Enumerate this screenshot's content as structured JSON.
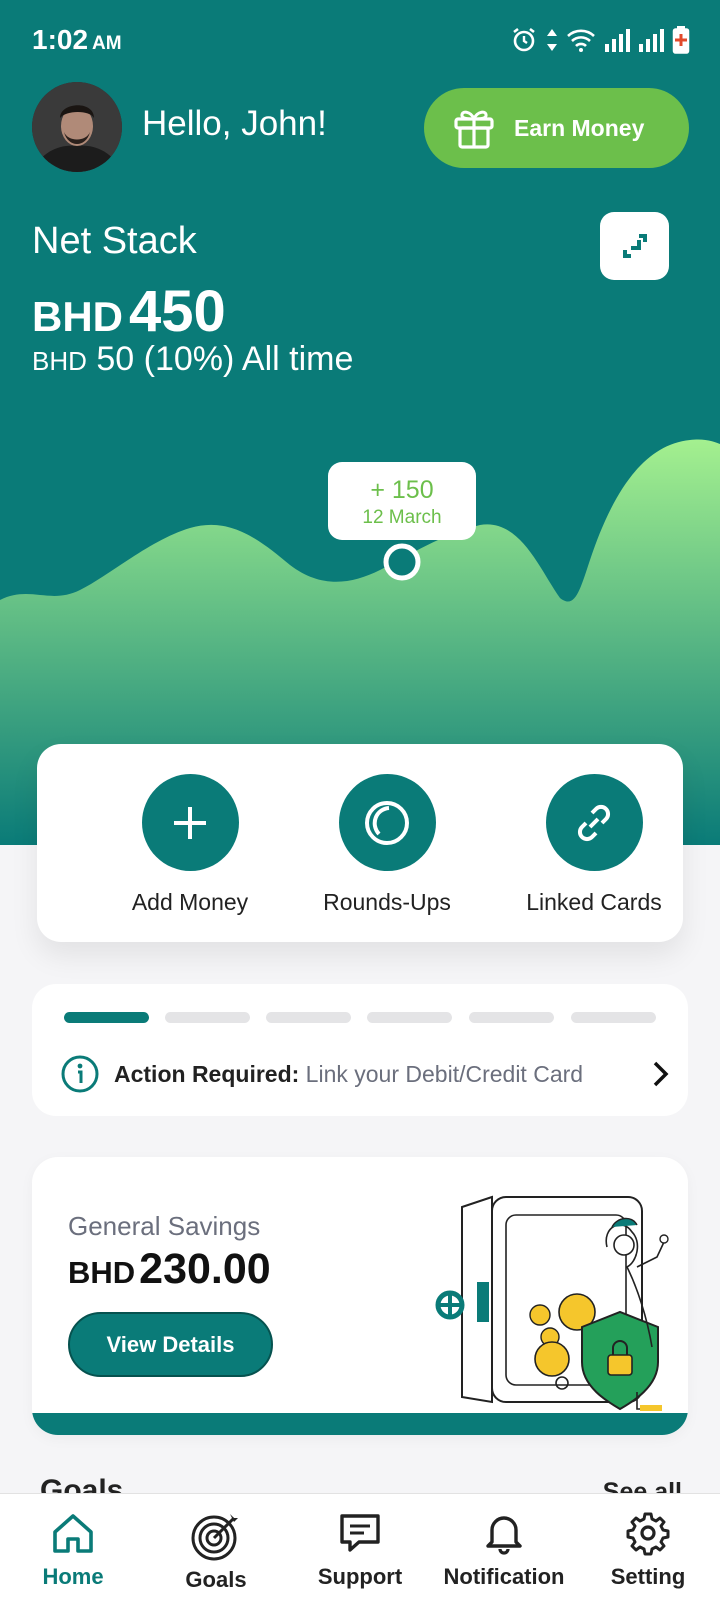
{
  "status_bar": {
    "time": "1:02",
    "ampm": "AM"
  },
  "header": {
    "greeting": "Hello, John!",
    "earn_button": "Earn Money"
  },
  "balance": {
    "label": "Net Stack",
    "currency": "BHD",
    "amount": "450",
    "change_currency": "BHD",
    "change_text": "50 (10%) All time"
  },
  "chart_data": {
    "type": "area",
    "tooltip": {
      "value": "+ 150",
      "date": "12 March"
    }
  },
  "quick_actions": [
    {
      "label": "Add Money",
      "icon": "plus-icon"
    },
    {
      "label": "Rounds-Ups",
      "icon": "coin-icon"
    },
    {
      "label": "Linked Cards",
      "icon": "link-icon"
    }
  ],
  "onboarding": {
    "steps_total": 6,
    "steps_done": 1,
    "action_label": "Action Required:",
    "action_text": "Link your Debit/Credit Card"
  },
  "savings": {
    "title": "General Savings",
    "currency": "BHD",
    "amount": "230.00",
    "button": "View Details"
  },
  "goals": {
    "title": "Goals",
    "see_all": "See all"
  },
  "nav": [
    {
      "label": "Home",
      "icon": "home-icon",
      "active": true
    },
    {
      "label": "Goals",
      "icon": "target-icon",
      "active": false
    },
    {
      "label": "Support",
      "icon": "chat-icon",
      "active": false
    },
    {
      "label": "Notification",
      "icon": "bell-icon",
      "active": false
    },
    {
      "label": "Setting",
      "icon": "gear-icon",
      "active": false
    }
  ],
  "colors": {
    "primary": "#0a7b78",
    "accent": "#6cbf4b",
    "chart_light": "#a4f08f"
  }
}
